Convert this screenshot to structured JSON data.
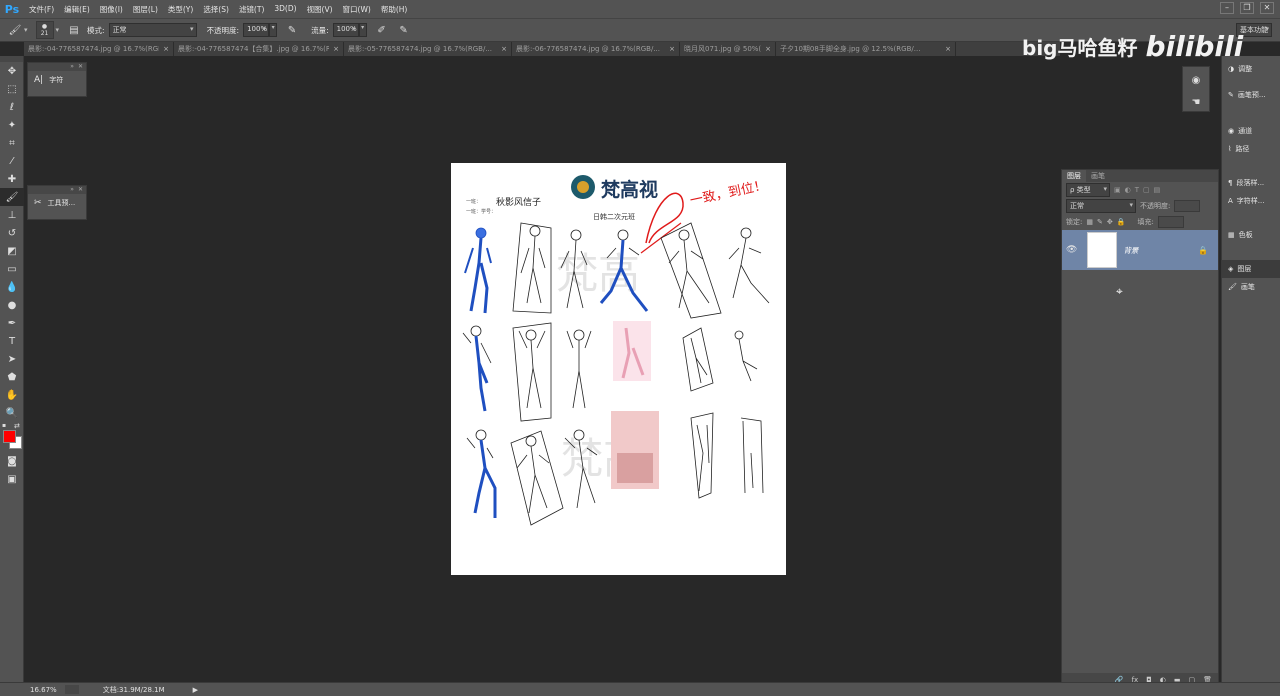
{
  "app": {
    "logo": "Ps"
  },
  "menu": [
    "文件(F)",
    "编辑(E)",
    "图像(I)",
    "图层(L)",
    "类型(Y)",
    "选择(S)",
    "滤镜(T)",
    "3D(D)",
    "视图(V)",
    "窗口(W)",
    "帮助(H)"
  ],
  "options": {
    "brush_size": "21",
    "mode_label": "模式:",
    "mode_value": "正常",
    "opacity_label": "不透明度:",
    "opacity_value": "100%",
    "flow_label": "流量:",
    "flow_value": "100%",
    "workspace": "基本功能"
  },
  "tabs": [
    "晨影:-04-776587474.jpg @ 16.7%(RGB/...",
    "晨影:-04-776587474【合集】.jpg @ 16.7%(RG...",
    "晨影:-05-776587474.jpg @ 16.7%(RGB/...",
    "晨影:-06-776587474.jpg @ 16.7%(RGB/...",
    "晓月风071.jpg @ 50%(RGB...",
    "子夕10期08手脚全身.jpg @ 12.5%(RGB/..."
  ],
  "panels": {
    "char_label": "字符",
    "tool_preset_label": "工具预..."
  },
  "canvas_doc": {
    "brand": "梵高视",
    "subtitle": "日韩二次元班",
    "left_lines": [
      "一班：",
      "一班：学号：",
      "……"
    ],
    "signature": "秋影风信子",
    "red_note": "一致，到位！"
  },
  "layers": {
    "tab_layers": "图层",
    "tab_channels": "画笔",
    "filter_kind": "ρ 类型",
    "blend_mode": "正常",
    "opacity_label": "不透明度:",
    "lock_label": "锁定:",
    "fill_label": "填充:",
    "layer_name": "背景"
  },
  "dock": [
    "调整",
    "画笔预...",
    "通道",
    "路径",
    "段落样...",
    "字符样...",
    "色板",
    "图层",
    "画笔"
  ],
  "status": {
    "zoom": "16.67%",
    "doc": "文档:31.9M/28.1M"
  },
  "watermark": {
    "text": "big马哈鱼籽",
    "logo": "bilibili"
  },
  "colors": {
    "foreground": "#ff0000",
    "background": "#ffffff",
    "layer_selected": "#6f85a7"
  }
}
